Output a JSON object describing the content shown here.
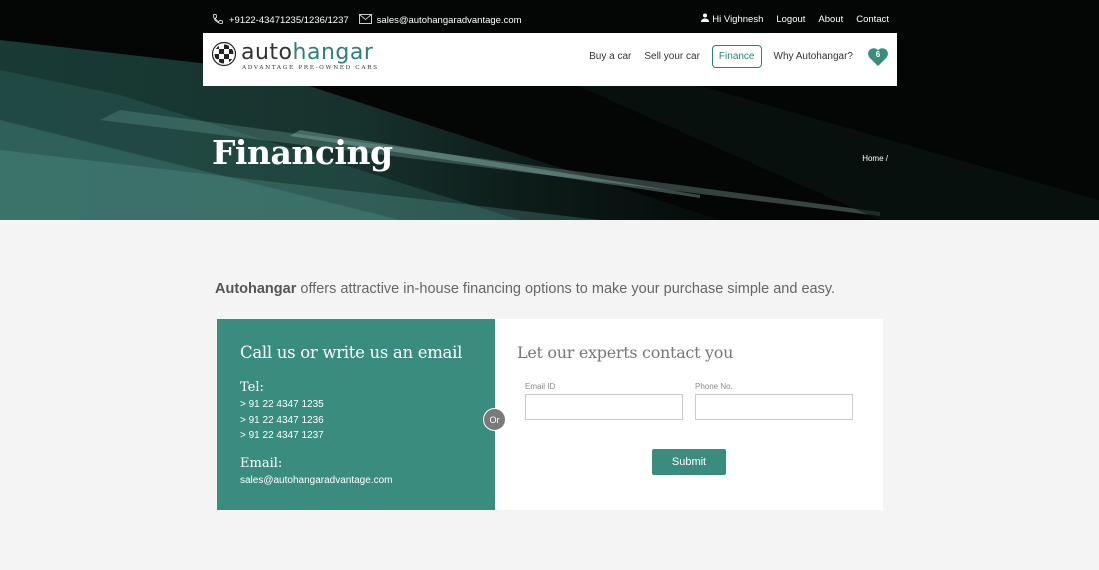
{
  "topbar": {
    "phone": "+9122-43471235/1236/1237",
    "email": "sales@autohangaradvantage.com",
    "user_greeting": "Hi Vighnesh",
    "links": [
      "Logout",
      "About",
      "Contact"
    ]
  },
  "logo": {
    "word_part1": "auto",
    "word_part2": "hangar",
    "tagline": "ADVANTAGE PRE-OWNED CARS"
  },
  "nav": {
    "items": [
      "Buy a car",
      "Sell your car",
      "Finance",
      "Why Autohangar?"
    ],
    "active": "Finance",
    "favorites_count": "6"
  },
  "hero": {
    "title": "Financing",
    "breadcrumb": "Home /"
  },
  "intro": {
    "brand": "Autohangar",
    "text": " offers attractive in-house financing options to make your purchase simple and easy."
  },
  "contact_card": {
    "heading": "Call us or write us an email",
    "tel_label": "Tel:",
    "phones": [
      "> 91 22 4347 1235",
      "> 91 22 4347 1236",
      "> 91 22 4347 1237"
    ],
    "email_label": "Email:",
    "email": "sales@autohangaradvantage.com"
  },
  "or_label": "Or",
  "form": {
    "heading": "Let our experts contact you",
    "email_label": "Email ID",
    "email_value": "",
    "phone_label": "Phone No.",
    "phone_value": "",
    "submit_label": "Submit"
  },
  "colors": {
    "accent": "#3a8c7f",
    "page_bg": "#f4f4f4",
    "hero_bg": "#000000"
  }
}
